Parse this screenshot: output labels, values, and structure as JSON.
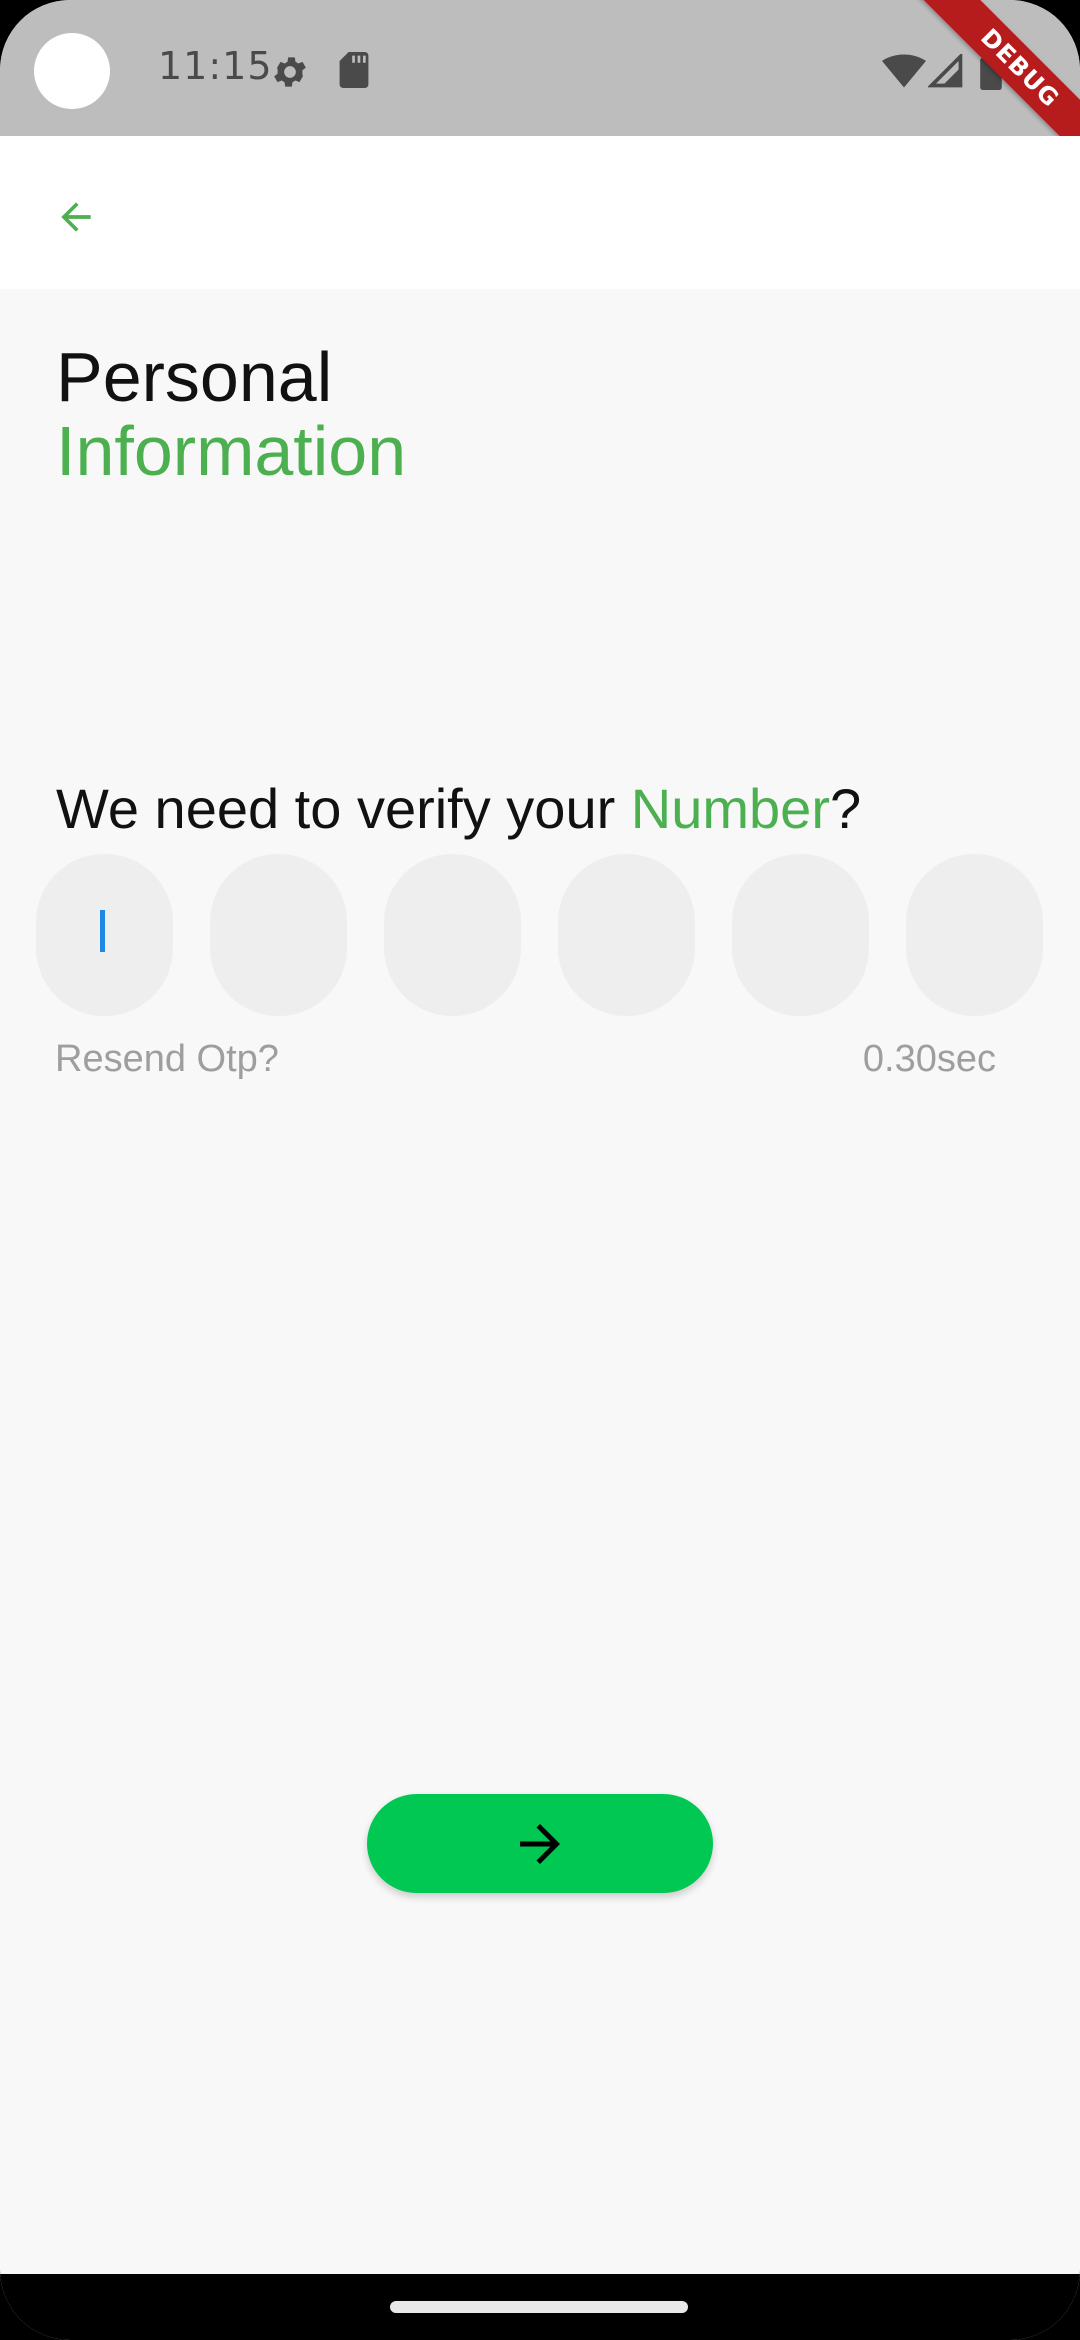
{
  "status_bar": {
    "time": "11:15",
    "icons": [
      "settings-icon",
      "sd-card-icon",
      "wifi-icon",
      "signal-icon",
      "battery-icon"
    ]
  },
  "debug_banner": "DEBUG",
  "app_bar": {
    "back_icon": "arrow-left-icon"
  },
  "page": {
    "title_line1": "Personal",
    "title_line2": "Information",
    "prompt_prefix": "We need to verify your ",
    "prompt_highlight": "Number",
    "prompt_suffix": "?"
  },
  "otp": {
    "digits": [
      "",
      "",
      "",
      "",
      "",
      ""
    ],
    "focused_index": 0
  },
  "resend_label": "Resend Otp?",
  "timer_label": "0.30sec",
  "next_button": {
    "icon": "arrow-right-icon"
  },
  "colors": {
    "accent_green": "#4caf50",
    "button_green": "#00c853",
    "status_bar_bg": "#bdbdbd",
    "otp_box_bg": "#eeeeee",
    "caret_blue": "#1e88e5",
    "muted_text": "#9e9e9e"
  }
}
